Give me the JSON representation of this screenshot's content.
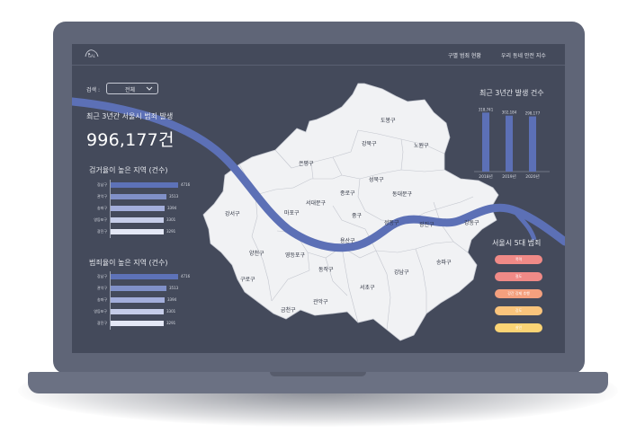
{
  "nav": {
    "logo_text": "GAL",
    "items": [
      "구별 범죄 현황",
      "우리 동네 안전 지수"
    ]
  },
  "search": {
    "label": "검색 :",
    "value": "전체"
  },
  "summary": {
    "subtitle": "최근 3년간 서울시 범죄 발생",
    "total": "996,177건"
  },
  "arrest_ranking": {
    "title": "검거율이 높은 지역 (건수)",
    "items": [
      {
        "district": "강남구",
        "value": 4716,
        "value_label": "4716",
        "color": "#5d72b8"
      },
      {
        "district": "관악구",
        "value": 3513,
        "value_label": "3513",
        "color": "#8090c8"
      },
      {
        "district": "송파구",
        "value": 3394,
        "value_label": "3394",
        "color": "#a3aedb"
      },
      {
        "district": "영등포구",
        "value": 3301,
        "value_label": "3301",
        "color": "#c6cde9"
      },
      {
        "district": "광진구",
        "value": 3291,
        "value_label": "3291",
        "color": "#e4e8f6"
      }
    ]
  },
  "crime_ranking": {
    "title": "범죄율이 높은 지역 (건수)",
    "items": [
      {
        "district": "강남구",
        "value": 4716,
        "value_label": "4716",
        "color": "#5d72b8"
      },
      {
        "district": "관악구",
        "value": 3513,
        "value_label": "3513",
        "color": "#8090c8"
      },
      {
        "district": "송파구",
        "value": 3394,
        "value_label": "3394",
        "color": "#a3aedb"
      },
      {
        "district": "영등포구",
        "value": 3301,
        "value_label": "3301",
        "color": "#c6cde9"
      },
      {
        "district": "광진구",
        "value": 3291,
        "value_label": "3291",
        "color": "#e4e8f6"
      }
    ]
  },
  "map": {
    "districts": [
      "도봉구",
      "강북구",
      "노원구",
      "은평구",
      "성북구",
      "종로구",
      "동대문구",
      "서대문구",
      "중구",
      "마포구",
      "강서구",
      "성동구",
      "광진구",
      "강동구",
      "용산구",
      "양천구",
      "영등포구",
      "동작구",
      "송파구",
      "구로구",
      "강남구",
      "서초구",
      "금천구",
      "관악구"
    ],
    "map_color": "#f1f2f4",
    "river_color": "#5c70b6"
  },
  "chart_data": {
    "type": "bar",
    "title": "최근 3년간 발생 건수",
    "categories": [
      "2018년",
      "2019년",
      "2020년"
    ],
    "values": [
      318741,
      302184,
      298177
    ],
    "value_labels": [
      "318,741",
      "302,184",
      "298,177"
    ],
    "ylim": [
      0,
      330000
    ],
    "color": "#5c70b6"
  },
  "five_crimes": {
    "title": "서울시 5대 범죄",
    "items": [
      {
        "label": "폭력",
        "color": "#f08a87"
      },
      {
        "label": "절도",
        "color": "#f08a87"
      },
      {
        "label": "강간 강제 추행",
        "color": "#f4a07e"
      },
      {
        "label": "강도",
        "color": "#fac47c"
      },
      {
        "label": "살인",
        "color": "#fbd475"
      }
    ]
  }
}
